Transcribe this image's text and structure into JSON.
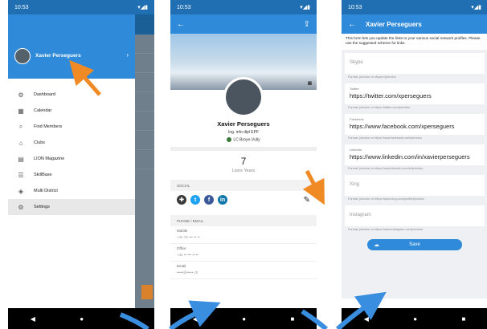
{
  "screen1": {
    "status_time": "10:53",
    "user_name": "Xavier Perseguers",
    "chevron": "›",
    "menu": [
      {
        "label": "Dashboard",
        "icon": "dashboard-icon",
        "glyph": "⚙"
      },
      {
        "label": "Calendar",
        "icon": "calendar-icon",
        "glyph": "▦"
      },
      {
        "label": "Find Members",
        "icon": "search-icon",
        "glyph": "⌕"
      },
      {
        "label": "Clubs",
        "icon": "clubs-icon",
        "glyph": "⌂"
      },
      {
        "label": "LION Magazine",
        "icon": "magazine-icon",
        "glyph": "▤"
      },
      {
        "label": "SkillBase",
        "icon": "list-icon",
        "glyph": "☰"
      },
      {
        "label": "Multi District",
        "icon": "layers-icon",
        "glyph": "◈"
      },
      {
        "label": "Settings",
        "icon": "settings-icon",
        "glyph": "⚙"
      }
    ]
  },
  "screen2": {
    "status_time": "10:53",
    "name": "Xavier Perseguers",
    "subtitle": "Ing. info dipl EPF",
    "club": "LC Broye-Vully",
    "years_value": "7",
    "years_label": "Lions Years",
    "social_title": "SOCIAL",
    "phone_title": "PHONE / EMAIL",
    "fields": [
      {
        "label": "Mobile",
        "value": "+41 76 ••• •• ••"
      },
      {
        "label": "Office",
        "value": "+41 •• ••• •• ••"
      },
      {
        "label": "Email",
        "value": "•••••@•••••.ch"
      }
    ]
  },
  "screen3": {
    "status_time": "10:53",
    "title": "Xavier Perseguers",
    "intro": "This form lets you update the links to your various social network profiles. Please use the suggested scheme for links.",
    "fields": [
      {
        "label": "",
        "value": "",
        "placeholder": "Skype",
        "hint": "Format: johndoo or skype://johndoo"
      },
      {
        "label": "Twitter",
        "value": "https://twitter.com/xperseguers",
        "placeholder": "",
        "hint": "Format: johndoo or https://twitter.com/johndoo"
      },
      {
        "label": "Facebook",
        "value": "https://www.facebook.com/xperseguers",
        "placeholder": "",
        "hint": "Format: johndoo or https://www.facebook.com/johndoo"
      },
      {
        "label": "LinkedIn",
        "value": "https://www.linkedin.com/in/xavierperseguers",
        "placeholder": "",
        "hint": "Format: johndoo or https://www.linkedin.com/in/johndoo"
      },
      {
        "label": "",
        "value": "",
        "placeholder": "Xing",
        "hint": "Format: johndoo or https://www.xing.com/profile/johndoo"
      },
      {
        "label": "",
        "value": "",
        "placeholder": "Instagram",
        "hint": "Format: johndoo or https://www.instagram.com/johndoo"
      }
    ],
    "save_label": "Save"
  },
  "colors": {
    "primary": "#2f8bd9",
    "status": "#1f6fb2",
    "arrow": "#f08a24",
    "arrow_blue": "#3a8ee0"
  }
}
